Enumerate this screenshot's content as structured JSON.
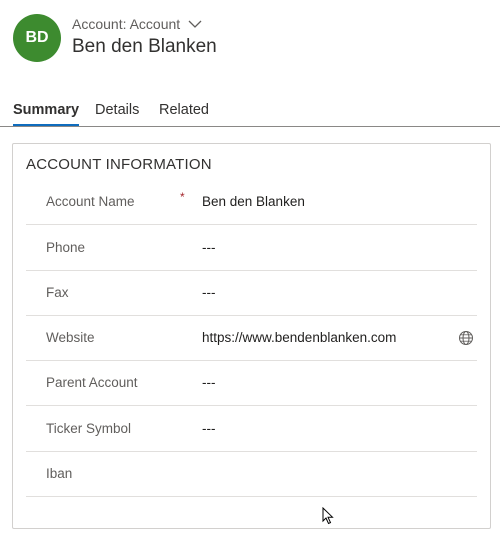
{
  "header": {
    "avatar_initials": "BD",
    "avatar_color": "#3d8b2f",
    "entity_type": "Account: Account",
    "record_name": "Ben den Blanken"
  },
  "tabs": [
    {
      "label": "Summary",
      "active": true
    },
    {
      "label": "Details",
      "active": false
    },
    {
      "label": "Related",
      "active": false
    }
  ],
  "section": {
    "title": "ACCOUNT INFORMATION",
    "fields": [
      {
        "label": "Account Name",
        "value": "Ben den Blanken",
        "required": "*"
      },
      {
        "label": "Phone",
        "value": "---"
      },
      {
        "label": "Fax",
        "value": "---"
      },
      {
        "label": "Website",
        "value": "https://www.bendenblanken.com",
        "icon": "globe-icon"
      },
      {
        "label": "Parent Account",
        "value": "---"
      },
      {
        "label": "Ticker Symbol",
        "value": "---"
      },
      {
        "label": "Iban",
        "value": ""
      }
    ]
  },
  "colors": {
    "accent": "#0f6cbd",
    "required": "#a4262c"
  }
}
